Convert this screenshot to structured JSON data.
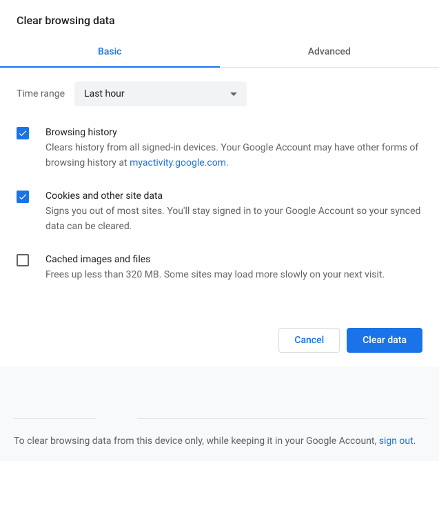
{
  "dialog": {
    "title": "Clear browsing data"
  },
  "tabs": {
    "basic": "Basic",
    "advanced": "Advanced"
  },
  "timeRange": {
    "label": "Time range",
    "selected": "Last hour"
  },
  "options": [
    {
      "checked": true,
      "title": "Browsing history",
      "descPrefix": "Clears history from all signed-in devices. Your Google Account may have other forms of browsing history at ",
      "link": "myactivity.google.com",
      "descSuffix": "."
    },
    {
      "checked": true,
      "title": "Cookies and other site data",
      "descPrefix": "Signs you out of most sites. You'll stay signed in to your Google Account so your synced data can be cleared.",
      "link": "",
      "descSuffix": ""
    },
    {
      "checked": false,
      "title": "Cached images and files",
      "descPrefix": "Frees up less than 320 MB. Some sites may load more slowly on your next visit.",
      "link": "",
      "descSuffix": ""
    }
  ],
  "buttons": {
    "cancel": "Cancel",
    "clear": "Clear data"
  },
  "footer": {
    "textPrefix": "To clear browsing data from this device only, while keeping it in your Google Account, ",
    "link": "sign out",
    "textSuffix": "."
  }
}
